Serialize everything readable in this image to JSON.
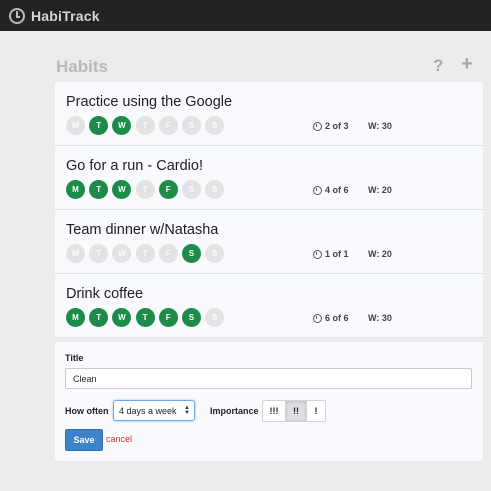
{
  "app": {
    "name": "HabiTrack"
  },
  "header": {
    "title": "Habits",
    "help_icon": "?",
    "add_icon": "+"
  },
  "habits": [
    {
      "title": "Practice using the Google",
      "days": [
        {
          "label": "M",
          "on": false
        },
        {
          "label": "T",
          "on": true
        },
        {
          "label": "W",
          "on": true
        },
        {
          "label": "T",
          "on": false
        },
        {
          "label": "F",
          "on": false
        },
        {
          "label": "S",
          "on": false
        },
        {
          "label": "S",
          "on": false
        }
      ],
      "count": "2 of 3",
      "weight": "W: 30"
    },
    {
      "title": "Go for a run - Cardio!",
      "days": [
        {
          "label": "M",
          "on": true
        },
        {
          "label": "T",
          "on": true
        },
        {
          "label": "W",
          "on": true
        },
        {
          "label": "T",
          "on": false
        },
        {
          "label": "F",
          "on": true
        },
        {
          "label": "S",
          "on": false
        },
        {
          "label": "S",
          "on": false
        }
      ],
      "count": "4 of 6",
      "weight": "W: 20"
    },
    {
      "title": "Team dinner w/Natasha",
      "days": [
        {
          "label": "M",
          "on": false
        },
        {
          "label": "T",
          "on": false
        },
        {
          "label": "W",
          "on": false
        },
        {
          "label": "T",
          "on": false
        },
        {
          "label": "F",
          "on": false
        },
        {
          "label": "S",
          "on": true
        },
        {
          "label": "S",
          "on": false
        }
      ],
      "count": "1 of 1",
      "weight": "W: 20"
    },
    {
      "title": "Drink coffee",
      "days": [
        {
          "label": "M",
          "on": true
        },
        {
          "label": "T",
          "on": true
        },
        {
          "label": "W",
          "on": true
        },
        {
          "label": "T",
          "on": true
        },
        {
          "label": "F",
          "on": true
        },
        {
          "label": "S",
          "on": true
        },
        {
          "label": "S",
          "on": false
        }
      ],
      "count": "6 of 6",
      "weight": "W: 30"
    }
  ],
  "form": {
    "title_label": "Title",
    "title_value": "Clean",
    "how_often_label": "How often",
    "how_often_value": "4 days a week",
    "importance_label": "Importance",
    "importance_options": [
      "!!!",
      "!!",
      "!"
    ],
    "importance_selected": 1,
    "save_label": "Save",
    "cancel_label": "cancel"
  },
  "colors": {
    "day_on": "#1d8b4a",
    "day_off": "#e3e3e3",
    "save": "#3c83c9",
    "cancel": "#c0392b",
    "topbar": "#232323"
  }
}
